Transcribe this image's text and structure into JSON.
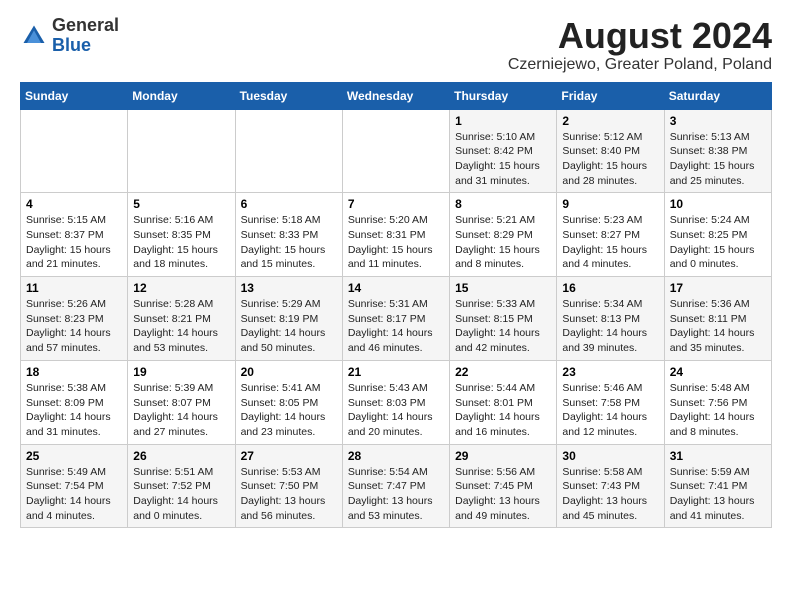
{
  "logo": {
    "general": "General",
    "blue": "Blue"
  },
  "title": "August 2024",
  "subtitle": "Czerniejewo, Greater Poland, Poland",
  "days_of_week": [
    "Sunday",
    "Monday",
    "Tuesday",
    "Wednesday",
    "Thursday",
    "Friday",
    "Saturday"
  ],
  "rows": [
    [
      {
        "day": "",
        "info": ""
      },
      {
        "day": "",
        "info": ""
      },
      {
        "day": "",
        "info": ""
      },
      {
        "day": "",
        "info": ""
      },
      {
        "day": "1",
        "info": "Sunrise: 5:10 AM\nSunset: 8:42 PM\nDaylight: 15 hours\nand 31 minutes."
      },
      {
        "day": "2",
        "info": "Sunrise: 5:12 AM\nSunset: 8:40 PM\nDaylight: 15 hours\nand 28 minutes."
      },
      {
        "day": "3",
        "info": "Sunrise: 5:13 AM\nSunset: 8:38 PM\nDaylight: 15 hours\nand 25 minutes."
      }
    ],
    [
      {
        "day": "4",
        "info": "Sunrise: 5:15 AM\nSunset: 8:37 PM\nDaylight: 15 hours\nand 21 minutes."
      },
      {
        "day": "5",
        "info": "Sunrise: 5:16 AM\nSunset: 8:35 PM\nDaylight: 15 hours\nand 18 minutes."
      },
      {
        "day": "6",
        "info": "Sunrise: 5:18 AM\nSunset: 8:33 PM\nDaylight: 15 hours\nand 15 minutes."
      },
      {
        "day": "7",
        "info": "Sunrise: 5:20 AM\nSunset: 8:31 PM\nDaylight: 15 hours\nand 11 minutes."
      },
      {
        "day": "8",
        "info": "Sunrise: 5:21 AM\nSunset: 8:29 PM\nDaylight: 15 hours\nand 8 minutes."
      },
      {
        "day": "9",
        "info": "Sunrise: 5:23 AM\nSunset: 8:27 PM\nDaylight: 15 hours\nand 4 minutes."
      },
      {
        "day": "10",
        "info": "Sunrise: 5:24 AM\nSunset: 8:25 PM\nDaylight: 15 hours\nand 0 minutes."
      }
    ],
    [
      {
        "day": "11",
        "info": "Sunrise: 5:26 AM\nSunset: 8:23 PM\nDaylight: 14 hours\nand 57 minutes."
      },
      {
        "day": "12",
        "info": "Sunrise: 5:28 AM\nSunset: 8:21 PM\nDaylight: 14 hours\nand 53 minutes."
      },
      {
        "day": "13",
        "info": "Sunrise: 5:29 AM\nSunset: 8:19 PM\nDaylight: 14 hours\nand 50 minutes."
      },
      {
        "day": "14",
        "info": "Sunrise: 5:31 AM\nSunset: 8:17 PM\nDaylight: 14 hours\nand 46 minutes."
      },
      {
        "day": "15",
        "info": "Sunrise: 5:33 AM\nSunset: 8:15 PM\nDaylight: 14 hours\nand 42 minutes."
      },
      {
        "day": "16",
        "info": "Sunrise: 5:34 AM\nSunset: 8:13 PM\nDaylight: 14 hours\nand 39 minutes."
      },
      {
        "day": "17",
        "info": "Sunrise: 5:36 AM\nSunset: 8:11 PM\nDaylight: 14 hours\nand 35 minutes."
      }
    ],
    [
      {
        "day": "18",
        "info": "Sunrise: 5:38 AM\nSunset: 8:09 PM\nDaylight: 14 hours\nand 31 minutes."
      },
      {
        "day": "19",
        "info": "Sunrise: 5:39 AM\nSunset: 8:07 PM\nDaylight: 14 hours\nand 27 minutes."
      },
      {
        "day": "20",
        "info": "Sunrise: 5:41 AM\nSunset: 8:05 PM\nDaylight: 14 hours\nand 23 minutes."
      },
      {
        "day": "21",
        "info": "Sunrise: 5:43 AM\nSunset: 8:03 PM\nDaylight: 14 hours\nand 20 minutes."
      },
      {
        "day": "22",
        "info": "Sunrise: 5:44 AM\nSunset: 8:01 PM\nDaylight: 14 hours\nand 16 minutes."
      },
      {
        "day": "23",
        "info": "Sunrise: 5:46 AM\nSunset: 7:58 PM\nDaylight: 14 hours\nand 12 minutes."
      },
      {
        "day": "24",
        "info": "Sunrise: 5:48 AM\nSunset: 7:56 PM\nDaylight: 14 hours\nand 8 minutes."
      }
    ],
    [
      {
        "day": "25",
        "info": "Sunrise: 5:49 AM\nSunset: 7:54 PM\nDaylight: 14 hours\nand 4 minutes."
      },
      {
        "day": "26",
        "info": "Sunrise: 5:51 AM\nSunset: 7:52 PM\nDaylight: 14 hours\nand 0 minutes."
      },
      {
        "day": "27",
        "info": "Sunrise: 5:53 AM\nSunset: 7:50 PM\nDaylight: 13 hours\nand 56 minutes."
      },
      {
        "day": "28",
        "info": "Sunrise: 5:54 AM\nSunset: 7:47 PM\nDaylight: 13 hours\nand 53 minutes."
      },
      {
        "day": "29",
        "info": "Sunrise: 5:56 AM\nSunset: 7:45 PM\nDaylight: 13 hours\nand 49 minutes."
      },
      {
        "day": "30",
        "info": "Sunrise: 5:58 AM\nSunset: 7:43 PM\nDaylight: 13 hours\nand 45 minutes."
      },
      {
        "day": "31",
        "info": "Sunrise: 5:59 AM\nSunset: 7:41 PM\nDaylight: 13 hours\nand 41 minutes."
      }
    ]
  ]
}
